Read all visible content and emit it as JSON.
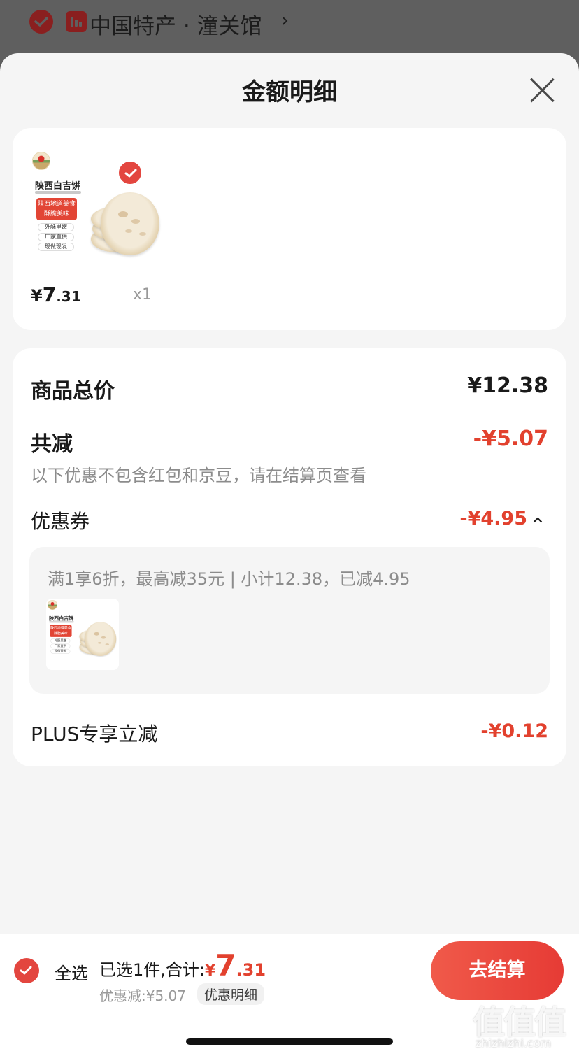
{
  "background": {
    "shop_name": "中国特产 · 潼关馆",
    "shop_arrow": "›"
  },
  "sheet": {
    "title": "金额明细",
    "close_icon": "close-icon"
  },
  "product": {
    "package_title": "陕西白吉饼",
    "package_banner": "陕西地道美食 酥脆美味",
    "package_tags": [
      "外酥里嫩",
      "厂家直供",
      "现做现发"
    ],
    "selected": true,
    "price_symbol": "¥",
    "price_int": "7",
    "price_dec": ".31",
    "quantity": "x1"
  },
  "summary": {
    "total_label": "商品总价",
    "total_value": "¥12.38",
    "reduce_label": "共减",
    "reduce_value": "-¥5.07",
    "note": "以下优惠不包含红包和京豆，请在结算页查看",
    "coupon_label": "优惠券",
    "coupon_value": "-¥4.95",
    "coupon_desc": "满1享6折，最高减35元 | 小计12.38，已减4.95",
    "plus_label": "PLUS专享立减",
    "plus_value": "-¥0.12"
  },
  "bottom_bar": {
    "select_all": "全选",
    "selected_text": "已选1件,合计:",
    "total_symbol": "¥",
    "total_int": "7",
    "total_dec": ".31",
    "discount_text": "优惠减:¥5.07",
    "detail_link": "优惠明细",
    "checkout": "去结算"
  },
  "watermark": {
    "glyphs": "值值值",
    "url": "zhizhizhi.com"
  },
  "colors": {
    "accent_red": "#e2412e",
    "sheet_bg": "#f5f5f5",
    "card_bg": "#ffffff"
  }
}
